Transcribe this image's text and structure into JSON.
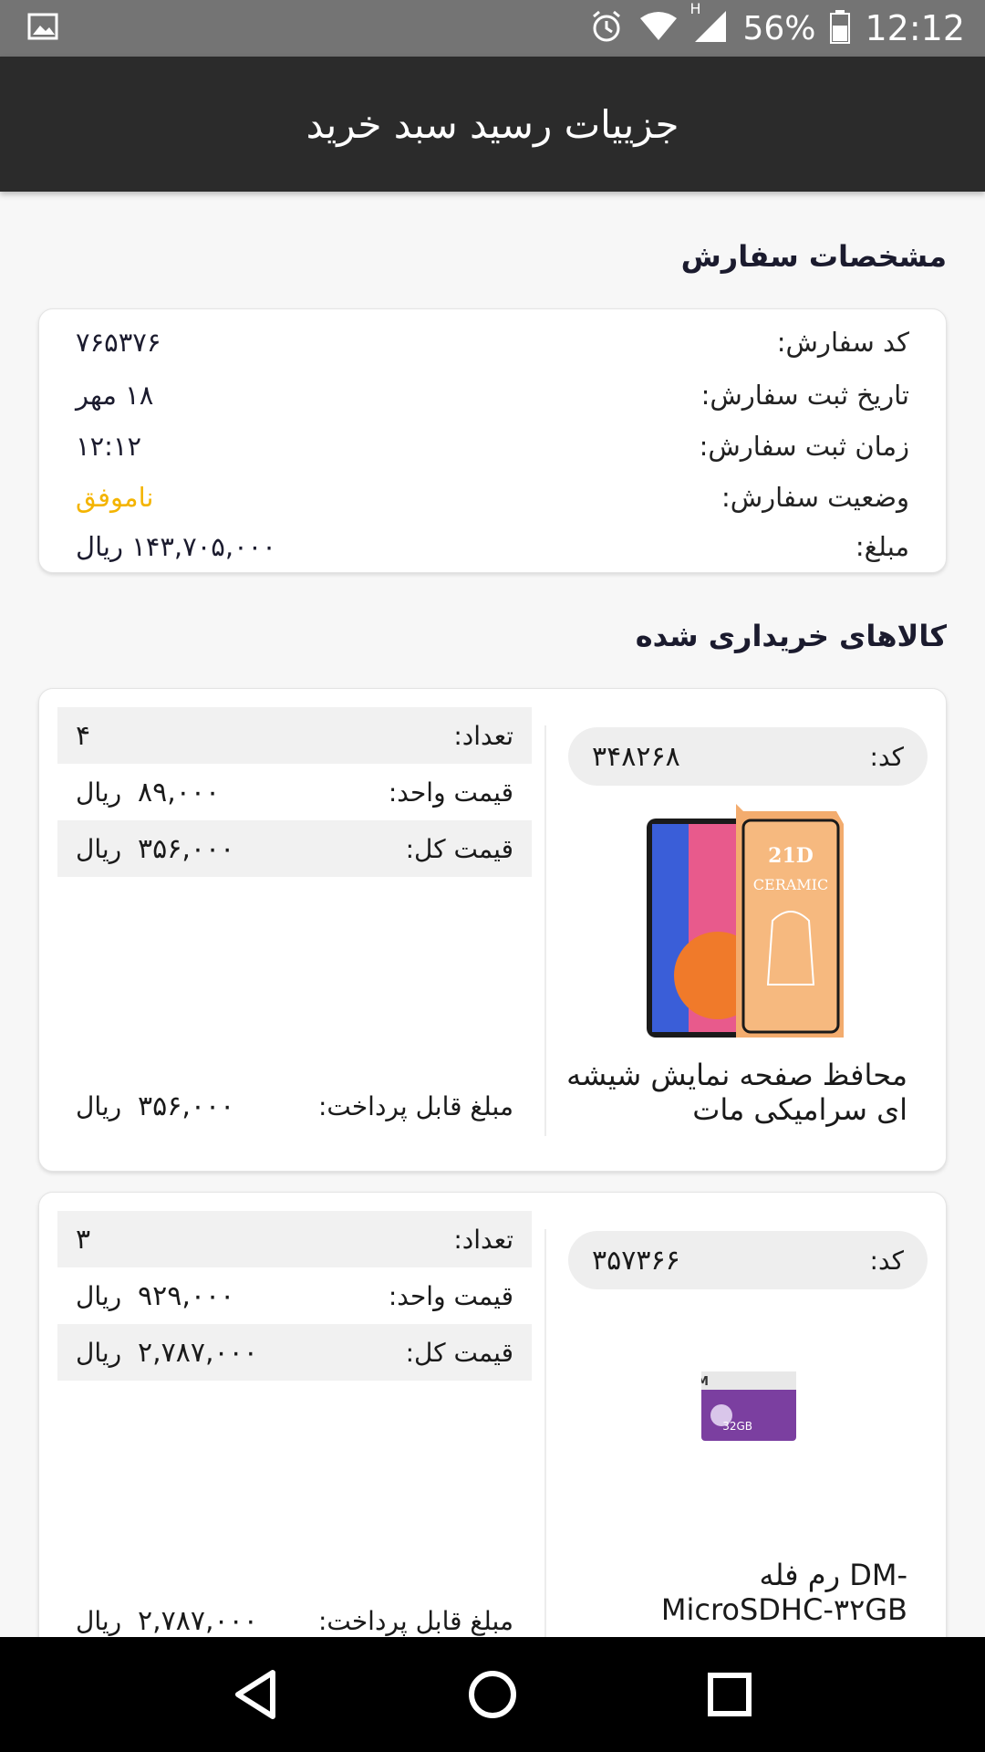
{
  "status_bar": {
    "battery": "56%",
    "time": "12:12",
    "network": "H"
  },
  "header": {
    "title": "جزییات رسید سبد خرید"
  },
  "order": {
    "section_title": "مشخصات سفارش",
    "rows": [
      {
        "label": "کد سفارش:",
        "value": "۷۶۵۳۷۶"
      },
      {
        "label": "تاریخ ثبت سفارش:",
        "value": "۱۸ مهر"
      },
      {
        "label": "زمان ثبت سفارش:",
        "value": "۱۲:۱۲"
      },
      {
        "label": "وضعیت سفارش:",
        "value": "ناموفق"
      },
      {
        "label": "مبلغ:",
        "value": "۱۴۳,۷۰۵,۰۰۰ ریال"
      }
    ],
    "status_color": "#f4b400"
  },
  "products": {
    "section_title": "کالاهای خریداری شده",
    "labels": {
      "code": "کد:",
      "quantity": "تعداد:",
      "unit_price": "قیمت واحد:",
      "total_price": "قیمت کل:",
      "payable": "مبلغ قابل پرداخت:",
      "currency": "ریال"
    },
    "items": [
      {
        "code": "۳۴۸۲۶۸",
        "name": "محافظ صفحه نمایش شیشه ای سرامیکی مات",
        "quantity": "۴",
        "unit_price": "۸۹,۰۰۰",
        "total_price": "۳۵۶,۰۰۰",
        "payable": "۳۵۶,۰۰۰",
        "image_text": "21D",
        "image_subtext": "CERAMIC"
      },
      {
        "code": "۳۵۷۳۶۶",
        "name": "رم فله DM- MicroSDHC-۳۲GB",
        "quantity": "۳",
        "unit_price": "۹۲۹,۰۰۰",
        "total_price": "۲,۷۸۷,۰۰۰",
        "payable": "۲,۷۸۷,۰۰۰",
        "image_text": "DM",
        "image_subtext": "32GB"
      }
    ]
  },
  "navigation": {
    "back": "back-icon",
    "home": "home-icon",
    "recents": "recents-icon"
  }
}
